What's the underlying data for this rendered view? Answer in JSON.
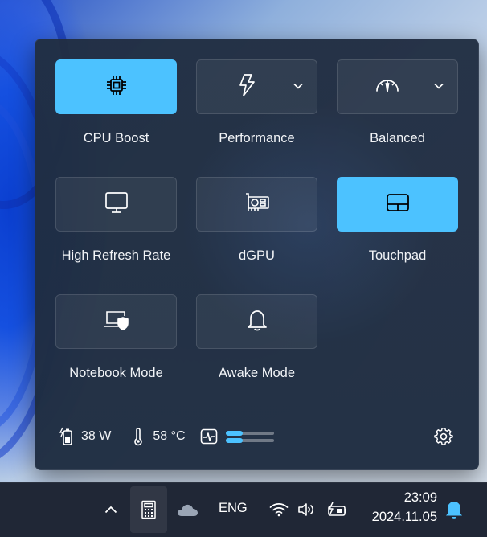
{
  "tiles": [
    {
      "label": "CPU Boost",
      "icon": "cpu-chip-icon",
      "active": true,
      "dropdown": false
    },
    {
      "label": "Performance",
      "icon": "lightning-icon",
      "active": false,
      "dropdown": true
    },
    {
      "label": "Balanced",
      "icon": "gauge-icon",
      "active": false,
      "dropdown": true
    },
    {
      "label": "High Refresh Rate",
      "icon": "monitor-icon",
      "active": false,
      "dropdown": false
    },
    {
      "label": "dGPU",
      "icon": "graphics-card-icon",
      "active": false,
      "dropdown": false
    },
    {
      "label": "Touchpad",
      "icon": "touchpad-icon",
      "active": true,
      "dropdown": false
    },
    {
      "label": "Notebook Mode",
      "icon": "laptop-shield-icon",
      "active": false,
      "dropdown": false
    },
    {
      "label": "Awake Mode",
      "icon": "bell-icon",
      "active": false,
      "dropdown": false
    }
  ],
  "status": {
    "power": "38 W",
    "temperature": "58 °C",
    "fan_levels": [
      0.35,
      0.35
    ]
  },
  "taskbar": {
    "language": "ENG",
    "time": "23:09",
    "date": "2024.11.05"
  },
  "colors": {
    "accent": "#4cc2ff",
    "panel": "#212e42",
    "taskbar": "#202736"
  }
}
